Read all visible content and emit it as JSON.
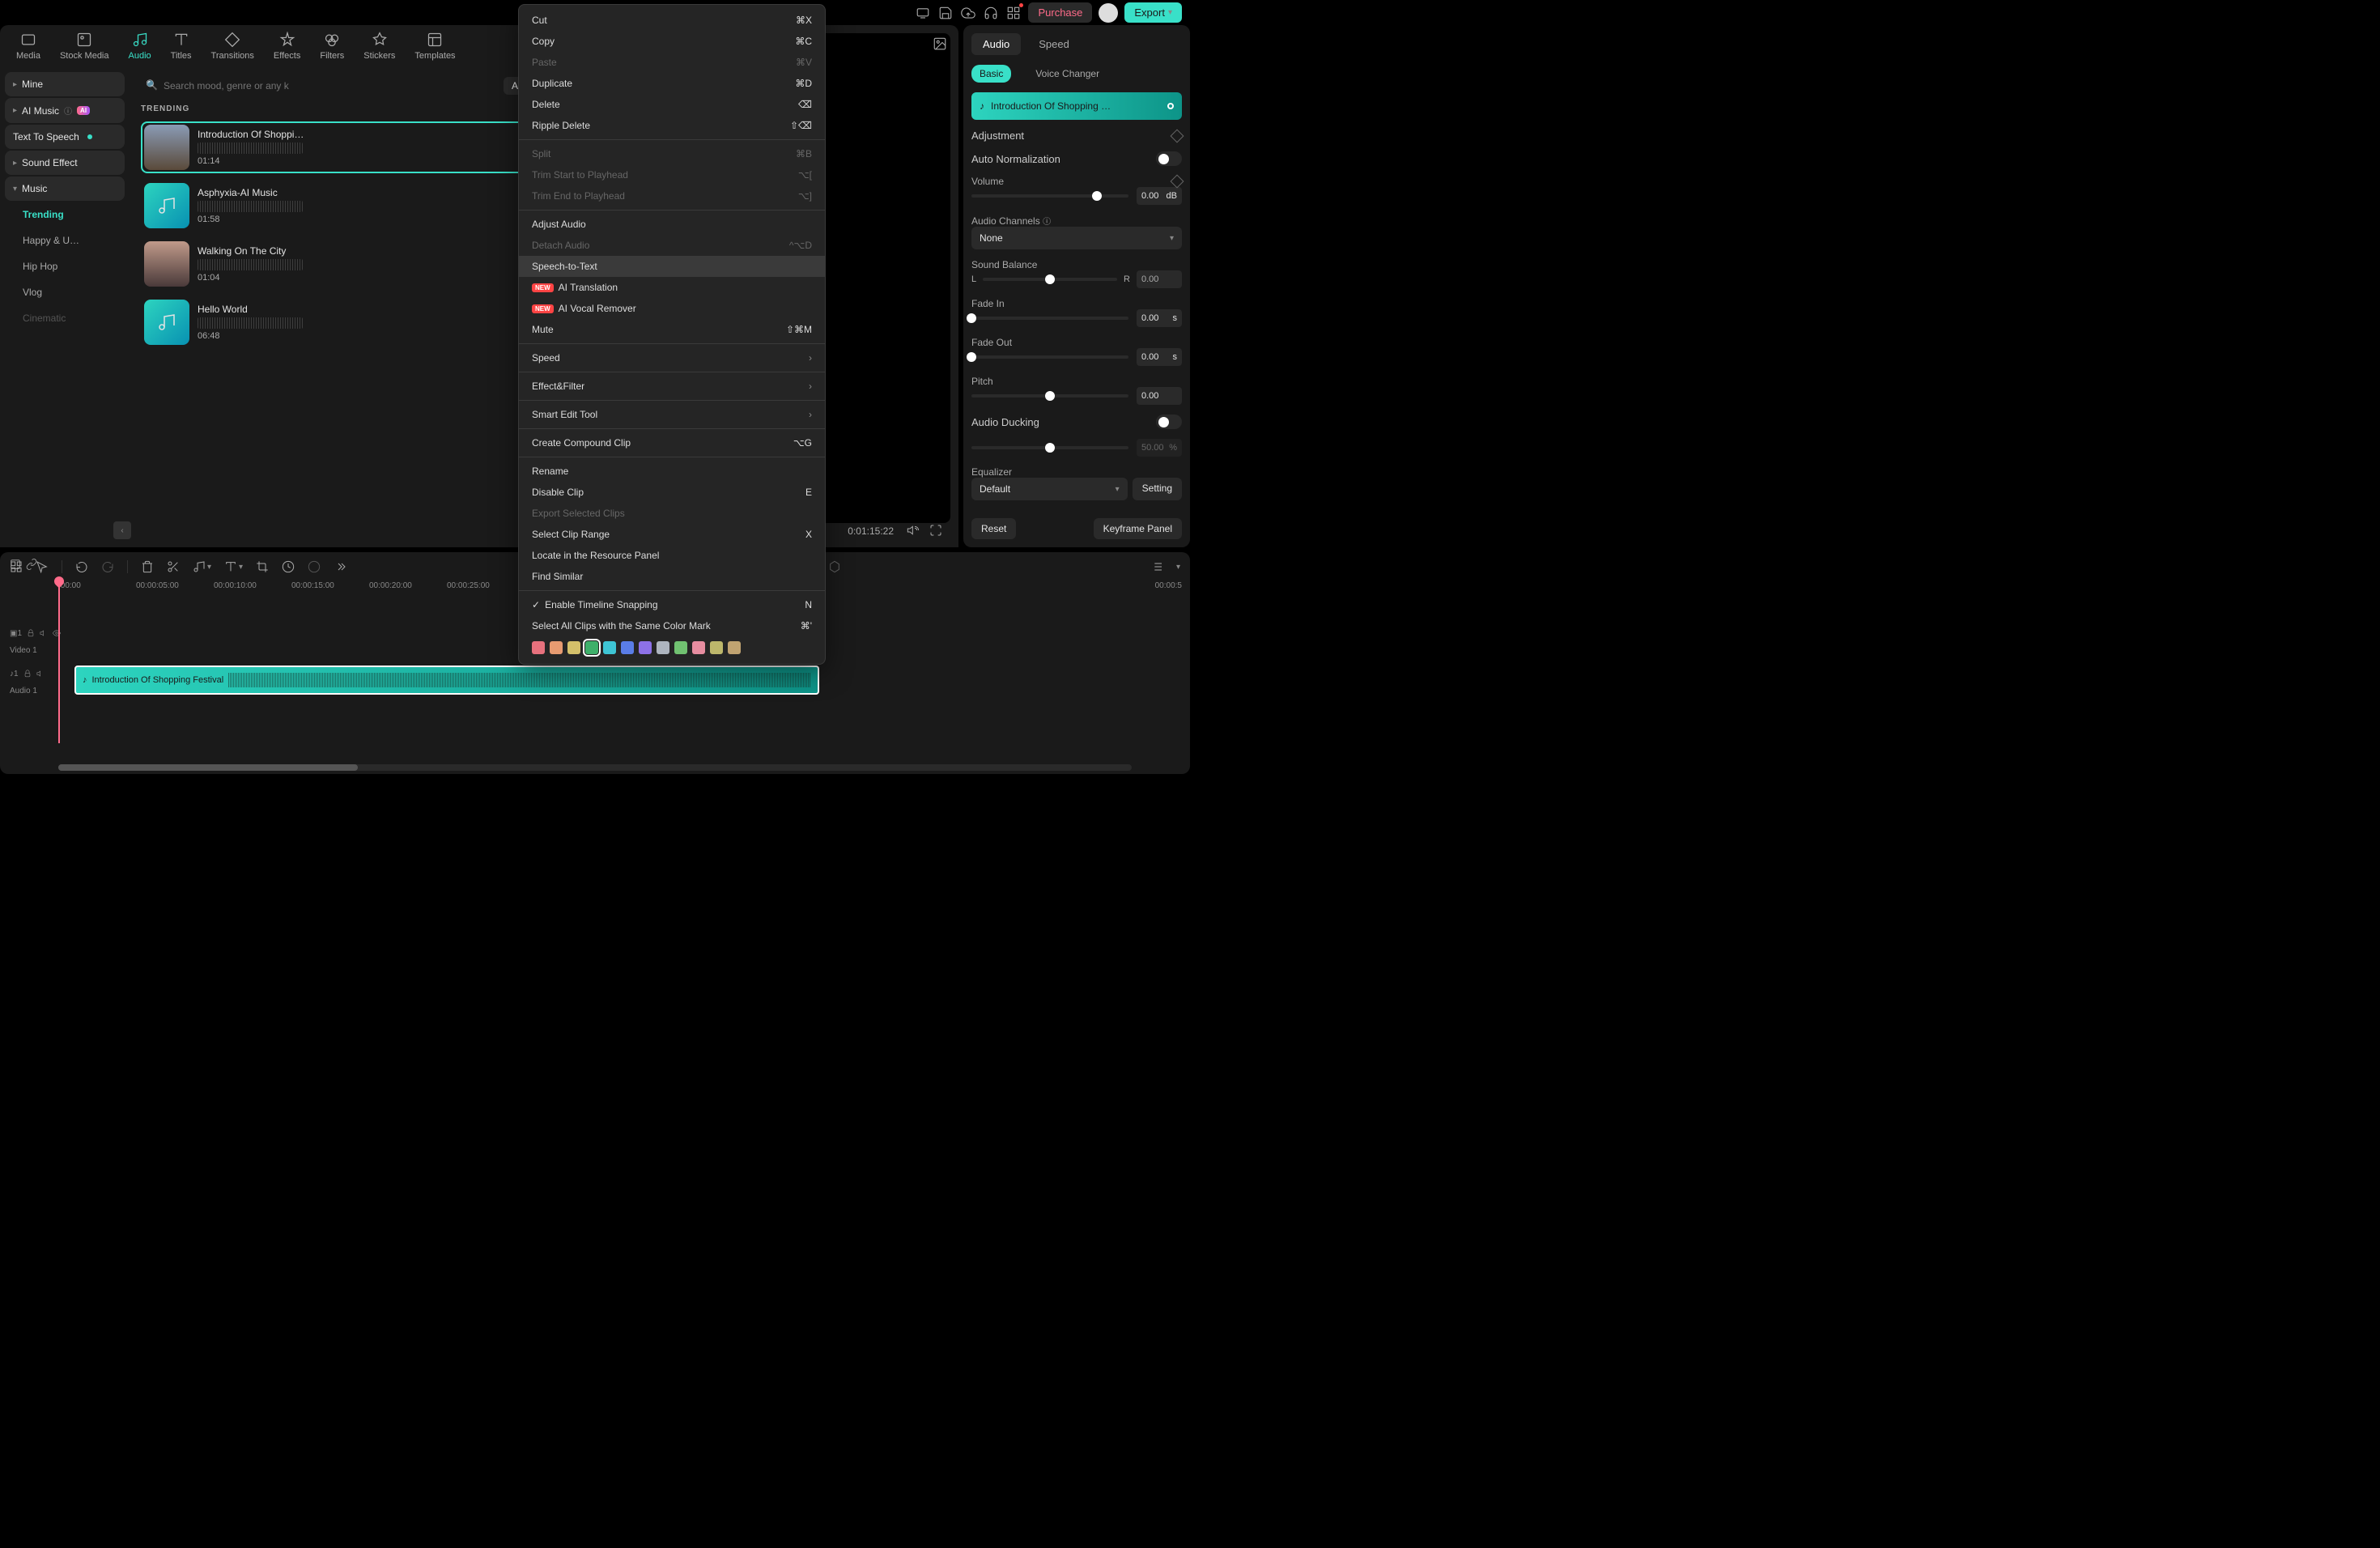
{
  "topbar": {
    "purchase": "Purchase",
    "export": "Export"
  },
  "nav": {
    "tabs": [
      "Media",
      "Stock Media",
      "Audio",
      "Titles",
      "Transitions",
      "Effects",
      "Filters",
      "Stickers",
      "Templates"
    ],
    "active": 2
  },
  "sidebar": {
    "mine": "Mine",
    "ai_music": "AI Music",
    "text_to_speech": "Text To Speech",
    "sound_effect": "Sound Effect",
    "music": "Music",
    "sub": [
      "Trending",
      "Happy & U…",
      "Hip Hop",
      "Vlog",
      "Cinematic"
    ]
  },
  "search": {
    "placeholder": "Search mood, genre or any keyword",
    "filter": "All"
  },
  "section_title": "TRENDING",
  "tracks": [
    {
      "name": "Introduction Of Shoppi…",
      "time": "01:14"
    },
    {
      "name": "Asphyxia-AI Music",
      "time": "01:58"
    },
    {
      "name": "Walking On The City",
      "time": "01:04"
    },
    {
      "name": "Hello World",
      "time": "06:48"
    }
  ],
  "preview": {
    "time": "0:01:15:22"
  },
  "right": {
    "tabs": [
      "Audio",
      "Speed"
    ],
    "subtabs": [
      "Basic",
      "Voice Changer"
    ],
    "chip": "Introduction Of Shopping …",
    "adjustment": "Adjustment",
    "auto_norm": "Auto Normalization",
    "volume": "Volume",
    "volume_val": "0.00",
    "volume_unit": "dB",
    "channels": "Audio Channels",
    "channels_val": "None",
    "balance": "Sound Balance",
    "balance_val": "0.00",
    "fade_in": "Fade In",
    "fade_in_val": "0.00",
    "fade_unit": "s",
    "fade_out": "Fade Out",
    "fade_out_val": "0.00",
    "pitch": "Pitch",
    "pitch_val": "0.00",
    "ducking": "Audio Ducking",
    "ducking_val": "50.00",
    "ducking_unit": "%",
    "equalizer": "Equalizer",
    "equalizer_val": "Default",
    "setting": "Setting",
    "reset": "Reset",
    "keyframe": "Keyframe Panel"
  },
  "timeline": {
    "marks": [
      ":00:00",
      "00:00:05:00",
      "00:00:10:00",
      "00:00:15:00",
      "00:00:20:00",
      "00:00:25:00"
    ],
    "far_mark": "00:00:5",
    "video_track": "Video 1",
    "video_num": "1",
    "audio_track": "Audio 1",
    "audio_num": "1",
    "clip": "Introduction Of Shopping Festival"
  },
  "context": {
    "items": [
      {
        "label": "Cut",
        "shortcut": "⌘X"
      },
      {
        "label": "Copy",
        "shortcut": "⌘C"
      },
      {
        "label": "Paste",
        "shortcut": "⌘V",
        "disabled": true
      },
      {
        "label": "Duplicate",
        "shortcut": "⌘D"
      },
      {
        "label": "Delete",
        "shortcut": "⌫"
      },
      {
        "label": "Ripple Delete",
        "shortcut": "⇧⌫"
      }
    ],
    "items2": [
      {
        "label": "Split",
        "shortcut": "⌘B",
        "disabled": true
      },
      {
        "label": "Trim Start to Playhead",
        "shortcut": "⌥[",
        "disabled": true
      },
      {
        "label": "Trim End to Playhead",
        "shortcut": "⌥]",
        "disabled": true
      }
    ],
    "items3": [
      {
        "label": "Adjust Audio"
      },
      {
        "label": "Detach Audio",
        "shortcut": "^⌥D",
        "disabled": true
      },
      {
        "label": "Speech-to-Text",
        "highlighted": true
      },
      {
        "label": "AI Translation",
        "badge": "NEW"
      },
      {
        "label": "AI Vocal Remover",
        "badge": "NEW"
      },
      {
        "label": "Mute",
        "shortcut": "⇧⌘M"
      }
    ],
    "items4": [
      {
        "label": "Speed",
        "sub": true
      }
    ],
    "items5": [
      {
        "label": "Effect&Filter",
        "sub": true
      }
    ],
    "items6": [
      {
        "label": "Smart Edit Tool",
        "sub": true
      }
    ],
    "items7": [
      {
        "label": "Create Compound Clip",
        "shortcut": "⌥G"
      }
    ],
    "items8": [
      {
        "label": "Rename"
      },
      {
        "label": "Disable Clip",
        "shortcut": "E"
      },
      {
        "label": "Export Selected Clips",
        "disabled": true
      },
      {
        "label": "Select Clip Range",
        "shortcut": "X"
      },
      {
        "label": "Locate in the Resource Panel"
      },
      {
        "label": "Find Similar"
      }
    ],
    "items9": [
      {
        "label": "Enable Timeline Snapping",
        "shortcut": "N",
        "checked": true
      },
      {
        "label": "Select All Clips with the Same Color Mark",
        "shortcut": "⌘'"
      }
    ],
    "colors": [
      "#e7717d",
      "#e79b71",
      "#d4c06a",
      "#3eb06a",
      "#3ec5d4",
      "#5a7de7",
      "#8d71e7",
      "#aeb5bf",
      "#71c271",
      "#e78da0",
      "#bdb76b",
      "#c0a371"
    ]
  }
}
